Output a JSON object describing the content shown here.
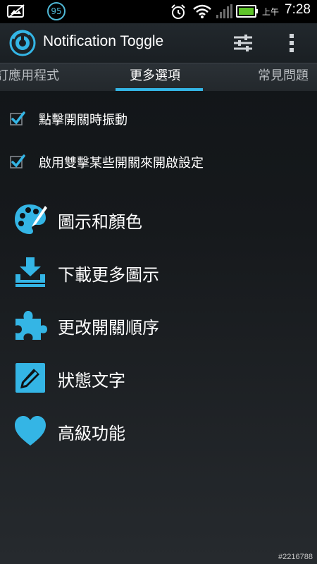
{
  "status_bar": {
    "badge": "95",
    "ampm": "上午",
    "time": "7:28",
    "icons": [
      "image-off-icon",
      "alarm-icon",
      "wifi-icon",
      "signal-icon",
      "battery-icon"
    ]
  },
  "action_bar": {
    "title": "Notification Toggle",
    "icons": [
      "app-toggle-icon",
      "settings-sliders-icon",
      "overflow-menu-icon"
    ]
  },
  "tabs": [
    {
      "label": "訂應用程式",
      "active": false
    },
    {
      "label": "更多選項",
      "active": true
    },
    {
      "label": "常見問題",
      "active": false
    }
  ],
  "options": [
    {
      "label": "點擊開關時振動",
      "checked": true
    },
    {
      "label": "啟用雙擊某些開關來開啟設定",
      "checked": true
    }
  ],
  "menu": [
    {
      "label": "圖示和顏色",
      "icon": "palette-icon"
    },
    {
      "label": "下載更多圖示",
      "icon": "download-icon"
    },
    {
      "label": "更改開關順序",
      "icon": "puzzle-icon"
    },
    {
      "label": "狀態文字",
      "icon": "edit-note-icon"
    },
    {
      "label": "高級功能",
      "icon": "heart-icon"
    }
  ],
  "watermark": "#2216788",
  "colors": {
    "accent": "#34b5e5",
    "background": "#16191c"
  }
}
